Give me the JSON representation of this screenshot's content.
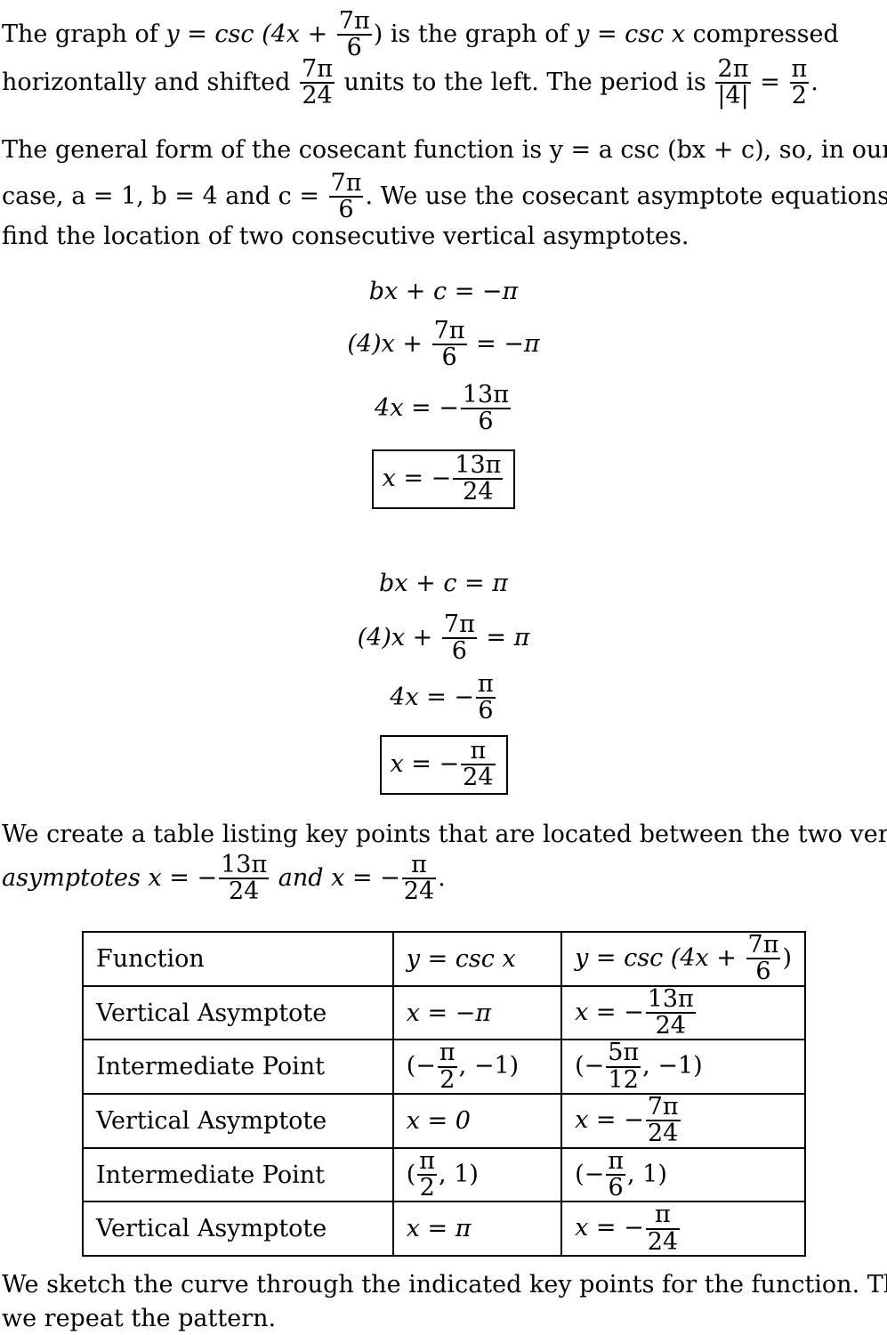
{
  "intro": {
    "p1_a": "The graph of ",
    "p1_func": "y = csc (4x + ",
    "p1_frac_num": "7π",
    "p1_frac_den": "6",
    "p1_b": ") is the graph of ",
    "p1_base": "y = csc x",
    "p1_c": " compressed",
    "p2_a": "horizontally and shifted ",
    "p2_frac_num": "7π",
    "p2_frac_den": "24",
    "p2_b": " units to the left. The period is ",
    "p2_per_num": "2π",
    "p2_per_den": "|4|",
    "p2_eq": " = ",
    "p2_res_num": "π",
    "p2_res_den": "2",
    "p2_end": "."
  },
  "general": {
    "l1": "The general form of the cosecant function is y = a csc (bx + c), so, in our",
    "l2_a": "case, a = 1, b = 4 and c = ",
    "l2_num": "7π",
    "l2_den": "6",
    "l2_b": ". We use the cosecant asymptote equations to",
    "l3": "find the location of two consecutive vertical asymptotes."
  },
  "derivation1": {
    "eq1": "bx + c = −π",
    "eq2_a": "(4)x + ",
    "eq2_num": "7π",
    "eq2_den": "6",
    "eq2_b": " = −π",
    "eq3_a": "4x = −",
    "eq3_num": "13π",
    "eq3_den": "6",
    "ans_a": "x = −",
    "ans_num": "13π",
    "ans_den": "24"
  },
  "derivation2": {
    "eq1": "bx + c = π",
    "eq2_a": "(4)x + ",
    "eq2_num": "7π",
    "eq2_den": "6",
    "eq2_b": " = π",
    "eq3_a": "4x = −",
    "eq3_num": "π",
    "eq3_den": "6",
    "ans_a": "x = −",
    "ans_num": "π",
    "ans_den": "24"
  },
  "table_intro": {
    "l1": "We create a table listing key points that are located between the two vertical",
    "l2_a": "asymptotes x = −",
    "l2_num1": "13π",
    "l2_den1": "24",
    "l2_b": " and x = −",
    "l2_num2": "π",
    "l2_den2": "24",
    "l2_end": "."
  },
  "table": {
    "header": {
      "c1": "Function",
      "c2": "y = csc x",
      "c3_a": "y = csc (4x + ",
      "c3_num": "7π",
      "c3_den": "6",
      "c3_b": ")"
    },
    "rows": [
      {
        "c1": "Vertical Asymptote",
        "c2_a": "x = −π",
        "c3_a": "x = −",
        "c3_num": "13π",
        "c3_den": "24",
        "c3_b": ""
      },
      {
        "c1": "Intermediate Point",
        "c2_a": "(−",
        "c2_num": "π",
        "c2_den": "2",
        "c2_b": ", −1)",
        "c3_a": "(−",
        "c3_num": "5π",
        "c3_den": "12",
        "c3_b": ", −1)"
      },
      {
        "c1": "Vertical Asymptote",
        "c2_a": "x = 0",
        "c3_a": "x = −",
        "c3_num": "7π",
        "c3_den": "24",
        "c3_b": ""
      },
      {
        "c1": "Intermediate Point",
        "c2_a": "(",
        "c2_num": "π",
        "c2_den": "2",
        "c2_b": ", 1)",
        "c3_a": "(−",
        "c3_num": "π",
        "c3_den": "6",
        "c3_b": ", 1)"
      },
      {
        "c1": "Vertical Asymptote",
        "c2_a": "x = π",
        "c3_a": "x = −",
        "c3_num": "π",
        "c3_den": "24",
        "c3_b": ""
      }
    ]
  },
  "closing": {
    "l1": "We sketch the curve through the indicated key points for the function. Then,",
    "l2": "we repeat the pattern."
  }
}
